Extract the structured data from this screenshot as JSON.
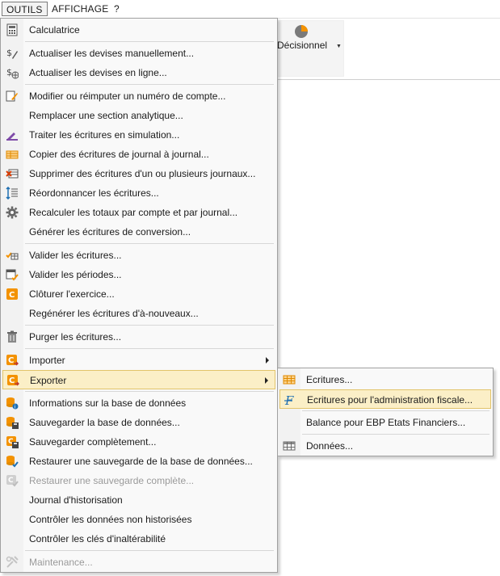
{
  "menubar": {
    "items": [
      {
        "label": "OUTILS",
        "active": true
      },
      {
        "label": "AFFICHAGE",
        "active": false
      },
      {
        "label": "?",
        "active": false
      }
    ]
  },
  "ribbon": {
    "decisionnel_label": "Décisionnel"
  },
  "menu": {
    "items": [
      {
        "label": "Calculatrice",
        "icon": "calculator-icon"
      },
      {
        "label": "Actualiser les devises manuellement...",
        "icon": "currency-edit-icon"
      },
      {
        "label": "Actualiser les devises en ligne...",
        "icon": "currency-online-icon"
      },
      {
        "label": "Modifier ou réimputer un numéro de compte...",
        "icon": "account-edit-icon"
      },
      {
        "label": "Remplacer une section analytique...",
        "icon": ""
      },
      {
        "label": "Traiter les écritures en simulation...",
        "icon": "simulation-icon"
      },
      {
        "label": "Copier des écritures de journal à journal...",
        "icon": "journal-copy-icon"
      },
      {
        "label": "Supprimer des écritures d'un ou plusieurs journaux...",
        "icon": "journal-delete-icon"
      },
      {
        "label": "Réordonnancer les écritures...",
        "icon": "reorder-icon"
      },
      {
        "label": "Recalculer les totaux par compte et par journal...",
        "icon": "gear-icon"
      },
      {
        "label": "Générer les écritures de conversion...",
        "icon": ""
      },
      {
        "label": "Valider les écritures...",
        "icon": "validate-entries-icon"
      },
      {
        "label": "Valider les périodes...",
        "icon": "validate-periods-icon"
      },
      {
        "label": "Clôturer l'exercice...",
        "icon": "close-year-icon"
      },
      {
        "label": "Regénérer les écritures d'à-nouveaux...",
        "icon": ""
      },
      {
        "label": "Purger les écritures...",
        "icon": "trash-icon"
      },
      {
        "label": "Importer",
        "icon": "import-icon"
      },
      {
        "label": "Exporter",
        "icon": "export-icon"
      },
      {
        "label": "Informations sur la base de données",
        "icon": "db-info-icon"
      },
      {
        "label": "Sauvegarder la base de données...",
        "icon": "db-save-icon"
      },
      {
        "label": "Sauvegarder complètement...",
        "icon": "full-save-icon"
      },
      {
        "label": "Restaurer une sauvegarde de la base de données...",
        "icon": "db-restore-icon"
      },
      {
        "label": "Restaurer une sauvegarde complète...",
        "icon": "full-restore-icon"
      },
      {
        "label": "Journal d'historisation",
        "icon": ""
      },
      {
        "label": "Contrôler les données non historisées",
        "icon": ""
      },
      {
        "label": "Contrôler les clés d'inaltérabilité",
        "icon": ""
      },
      {
        "label": "Maintenance...",
        "icon": "wrench-icon"
      }
    ]
  },
  "submenu": {
    "items": [
      {
        "label": "Ecritures...",
        "icon": "grid-icon"
      },
      {
        "label": "Ecritures pour l'administration fiscale...",
        "icon": "fec-icon"
      },
      {
        "label": "Balance pour EBP Etats Financiers...",
        "icon": ""
      },
      {
        "label": "Données...",
        "icon": "table-icon"
      }
    ]
  },
  "colors": {
    "highlight_bg": "#fbefc7",
    "highlight_border": "#e2c46a",
    "accent_orange": "#f39200",
    "accent_purple": "#7e4aa8",
    "accent_blue": "#1f6fb2"
  }
}
